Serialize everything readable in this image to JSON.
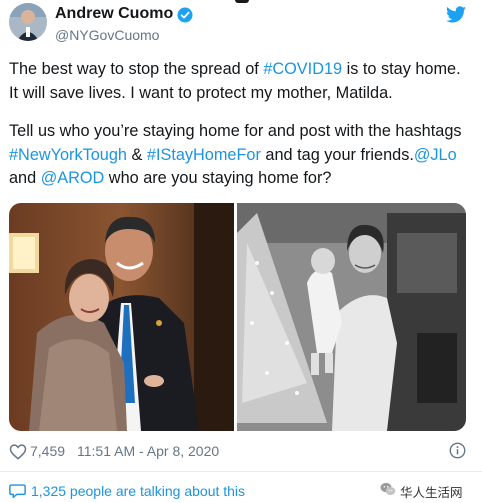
{
  "header": {
    "display_name": "Andrew Cuomo",
    "handle": "@NYGovCuomo",
    "verified_icon": "verified-badge-icon",
    "platform_icon": "twitter-bird-icon"
  },
  "tweet": {
    "line1_a": "The best way to stop the spread of ",
    "hashtag_covid": "#COVID19",
    "line1_b": " is to stay home. It will save lives. I want to protect my mother, Matilda.",
    "p2_a": "Tell us who you’re staying home for and post with the hashtags ",
    "hashtag_nyt": "#NewYorkTough",
    "p2_amp": " & ",
    "hashtag_ishf": "#IStayHomeFor",
    "p2_b": " and tag your friends.",
    "mention_jlo": "@JLo",
    "p2_c": " and ",
    "mention_arod": "@AROD",
    "p2_d": " who are you staying home for?"
  },
  "media": {
    "left_photo": "photo of Andrew Cuomo with his mother",
    "right_photo": "black-and-white photo of mother holding a baby by a Christmas tree"
  },
  "footer": {
    "like_icon": "heart-icon",
    "like_count": "7,459",
    "timestamp": "11:51 AM - Apr 8, 2020",
    "info_icon": "info-icon"
  },
  "conversation": {
    "icon": "chat-bubble-icon",
    "label": "1,325 people are talking about this"
  },
  "watermark": {
    "logo": "wechat-logo-icon",
    "text": "华人生活网"
  },
  "colors": {
    "link": "#1b95e0",
    "text": "#14171a",
    "secondary": "#657786",
    "verified": "#1da1f2"
  }
}
